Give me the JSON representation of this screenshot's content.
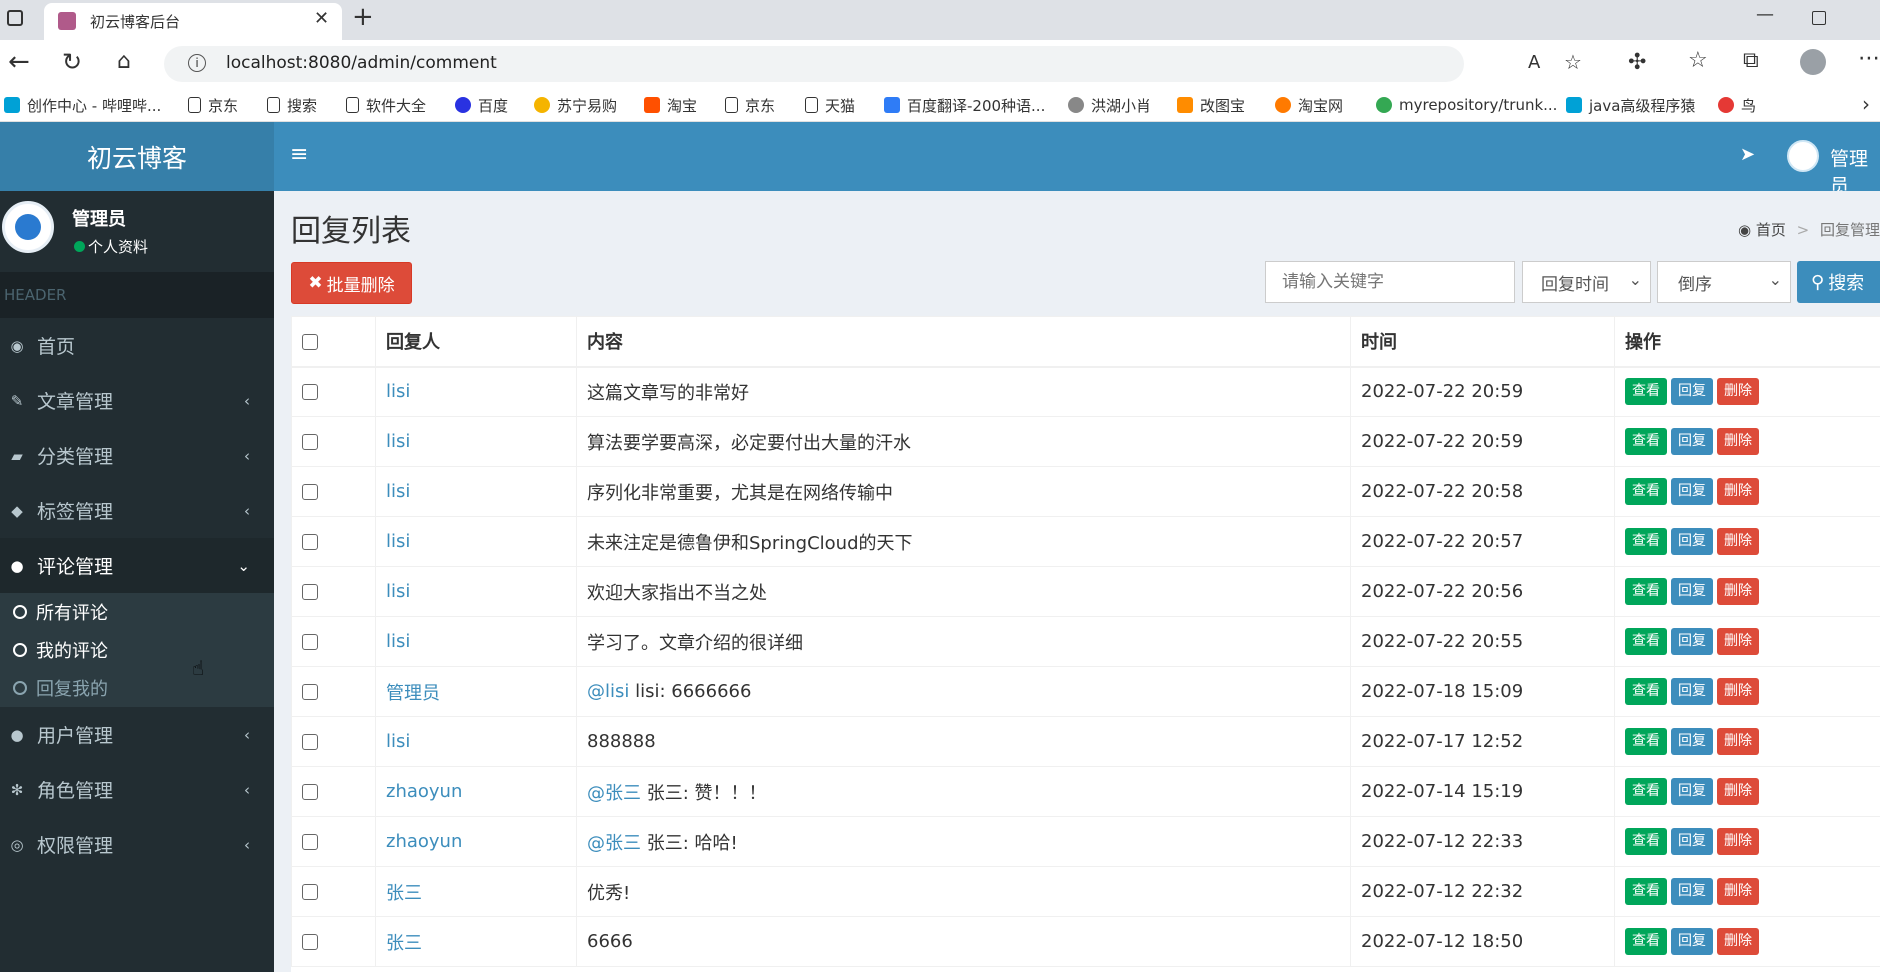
{
  "browser": {
    "tab_title": "初云博客后台",
    "url": "localhost:8080/admin/comment",
    "bookmarks": [
      "创作中心 - 哔哩哔...",
      "京东",
      "搜索",
      "软件大全",
      "百度",
      "苏宁易购",
      "淘宝",
      "京东",
      "天猫",
      "百度翻译-200种语...",
      "洪湖小肖",
      "改图宝",
      "淘宝网",
      "myrepository/trunk...",
      "java高级程序猿",
      "鸟"
    ]
  },
  "app": {
    "logo": "初云博客",
    "user_name": "管理员",
    "user_sub": "个人资料",
    "top_user": "管理员",
    "header_label": "HEADER"
  },
  "sidebar": {
    "items": [
      {
        "label": "首页",
        "icon": "dashboard-icon",
        "glyph": "◉",
        "chevron": ""
      },
      {
        "label": "文章管理",
        "icon": "brush-icon",
        "glyph": "✎",
        "chevron": "‹"
      },
      {
        "label": "分类管理",
        "icon": "book-icon",
        "glyph": "▰",
        "chevron": "‹"
      },
      {
        "label": "标签管理",
        "icon": "tag-icon",
        "glyph": "◆",
        "chevron": "‹"
      },
      {
        "label": "评论管理",
        "icon": "comment-icon",
        "glyph": "●",
        "chevron": "⌄"
      },
      {
        "label": "用户管理",
        "icon": "user-icon",
        "glyph": "●",
        "chevron": "‹"
      },
      {
        "label": "角色管理",
        "icon": "snowflake-icon",
        "glyph": "✻",
        "chevron": "‹"
      },
      {
        "label": "权限管理",
        "icon": "podcast-icon",
        "glyph": "◎",
        "chevron": "‹"
      }
    ],
    "subitems": [
      {
        "label": "所有评论"
      },
      {
        "label": "我的评论"
      },
      {
        "label": "回复我的"
      }
    ]
  },
  "page": {
    "title": "回复列表",
    "breadcrumb_home": "首页",
    "breadcrumb_current": "回复管理",
    "batch_delete": "批量删除",
    "search_placeholder": "请输入关键字",
    "sort_field": "回复时间",
    "sort_order": "倒序",
    "search_button": "搜索"
  },
  "table": {
    "headers": [
      "回复人",
      "内容",
      "时间",
      "操作"
    ],
    "actions": [
      "查看",
      "回复",
      "删除"
    ],
    "rows": [
      {
        "user": "lisi",
        "mention": "",
        "content": "这篇文章写的非常好",
        "time": "2022-07-22 20:59"
      },
      {
        "user": "lisi",
        "mention": "",
        "content": "算法要学要高深，必定要付出大量的汗水",
        "time": "2022-07-22 20:59"
      },
      {
        "user": "lisi",
        "mention": "",
        "content": "序列化非常重要，尤其是在网络传输中",
        "time": "2022-07-22 20:58"
      },
      {
        "user": "lisi",
        "mention": "",
        "content": "未来注定是德鲁伊和SpringCloud的天下",
        "time": "2022-07-22 20:57"
      },
      {
        "user": "lisi",
        "mention": "",
        "content": "欢迎大家指出不当之处",
        "time": "2022-07-22 20:56"
      },
      {
        "user": "lisi",
        "mention": "",
        "content": "学习了。文章介绍的很详细",
        "time": "2022-07-22 20:55"
      },
      {
        "user": "管理员",
        "mention": "@lisi",
        "content": " lisi: 6666666",
        "time": "2022-07-18 15:09"
      },
      {
        "user": "lisi",
        "mention": "",
        "content": "888888",
        "time": "2022-07-17 12:52"
      },
      {
        "user": "zhaoyun",
        "mention": "@张三",
        "content": " 张三: 赞！！！",
        "time": "2022-07-14 15:19"
      },
      {
        "user": "zhaoyun",
        "mention": "@张三",
        "content": " 张三: 哈哈!",
        "time": "2022-07-12 22:33"
      },
      {
        "user": "张三",
        "mention": "",
        "content": "优秀!",
        "time": "2022-07-12 22:32"
      },
      {
        "user": "张三",
        "mention": "",
        "content": "6666",
        "time": "2022-07-12 18:50"
      }
    ]
  },
  "colors": {
    "primary": "#3c8dbc",
    "sidebar": "#222d32",
    "danger": "#dd4b39",
    "success": "#00a65a"
  }
}
